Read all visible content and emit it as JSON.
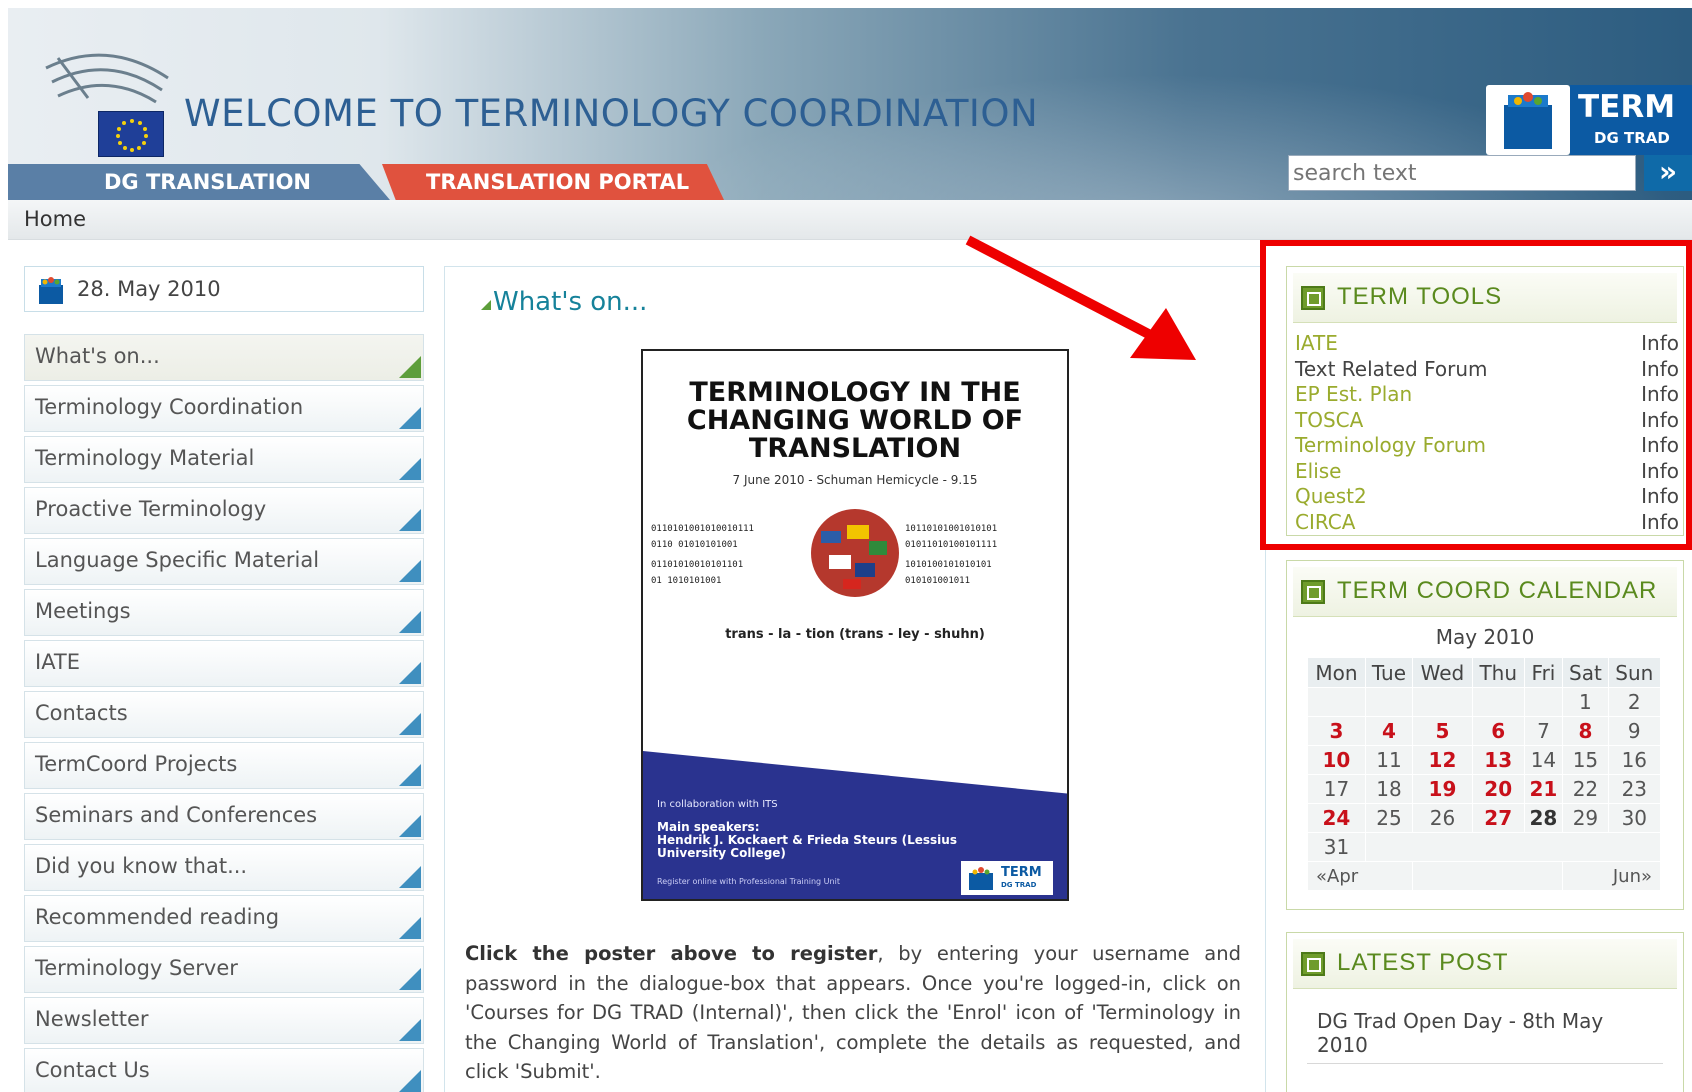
{
  "header": {
    "site_title": "WELCOME TO TERMINOLOGY COORDINATION",
    "term_logo_title": "TERM",
    "term_logo_sub": "DG TRAD",
    "nav": [
      "DG TRANSLATION",
      "TRANSLATION PORTAL"
    ],
    "search_placeholder": "search text",
    "search_go": "»"
  },
  "breadcrumb": "Home",
  "date_box": "28. May 2010",
  "left_menu": [
    "What's on...",
    "Terminology Coordination",
    "Terminology Material",
    "Proactive Terminology",
    "Language Specific Material",
    "Meetings",
    "IATE",
    "Contacts",
    "TermCoord Projects",
    "Seminars and Conferences",
    "Did you know that...",
    "Recommended reading",
    "Terminology Server",
    "Newsletter",
    "Contact Us"
  ],
  "center": {
    "title": "What's on...",
    "poster": {
      "title": "TERMINOLOGY IN THE CHANGING WORLD OF TRANSLATION",
      "date": "7 June 2010 - Schuman Hemicycle - 9.15",
      "phonetic": "trans - la - tion (trans - ley - shuhn)",
      "collab": "In collaboration with ITS",
      "speakers_label": "Main speakers:",
      "speakers": "Hendrik J. Kockaert & Frieda Steurs (Lessius University College)",
      "register": "Register online with Professional Training Unit",
      "logo_title": "TERM",
      "logo_sub": "DG TRAD"
    },
    "text_bold": "Click the poster above to register",
    "text_rest": ", by entering your username and password in the dialogue-box that appears. Once you're logged-in, click on 'Courses for DG TRAD (Internal)', then click the 'Enrol' icon of 'Terminology in the Changing World of Translation', complete the details as requested, and click 'Submit'."
  },
  "term_tools": {
    "title": "TERM TOOLS",
    "items": [
      {
        "name": "IATE",
        "info": "Info"
      },
      {
        "name": "Text Related Forum",
        "info": "Info"
      },
      {
        "name": "EP Est. Plan",
        "info": "Info"
      },
      {
        "name": "TOSCA",
        "info": "Info"
      },
      {
        "name": "Terminology Forum",
        "info": "Info"
      },
      {
        "name": "Elise",
        "info": "Info"
      },
      {
        "name": "Quest2",
        "info": "Info"
      },
      {
        "name": "CIRCA",
        "info": "Info"
      }
    ]
  },
  "calendar": {
    "title": "TERM COORD CALENDAR",
    "month": "May 2010",
    "days": [
      "Mon",
      "Tue",
      "Wed",
      "Thu",
      "Fri",
      "Sat",
      "Sun"
    ],
    "weeks": [
      [
        "",
        "",
        "",
        "",
        "",
        "1",
        "2"
      ],
      [
        "3",
        "4",
        "5",
        "6",
        "7",
        "8",
        "9"
      ],
      [
        "10",
        "11",
        "12",
        "13",
        "14",
        "15",
        "16"
      ],
      [
        "17",
        "18",
        "19",
        "20",
        "21",
        "22",
        "23"
      ],
      [
        "24",
        "25",
        "26",
        "27",
        "28",
        "29",
        "30"
      ],
      [
        "31",
        "",
        "",
        "",
        "",
        "",
        ""
      ]
    ],
    "prev": "«Apr",
    "next": "Jun»"
  },
  "latest_post": {
    "title": "LATEST POST",
    "item": "DG Trad Open Day - 8th May 2010"
  },
  "colors": {
    "accent_blue": "#16829a",
    "term_green": "#5a8a1e",
    "highlight_red": "#ee0000",
    "event_red": "#c8101a"
  }
}
